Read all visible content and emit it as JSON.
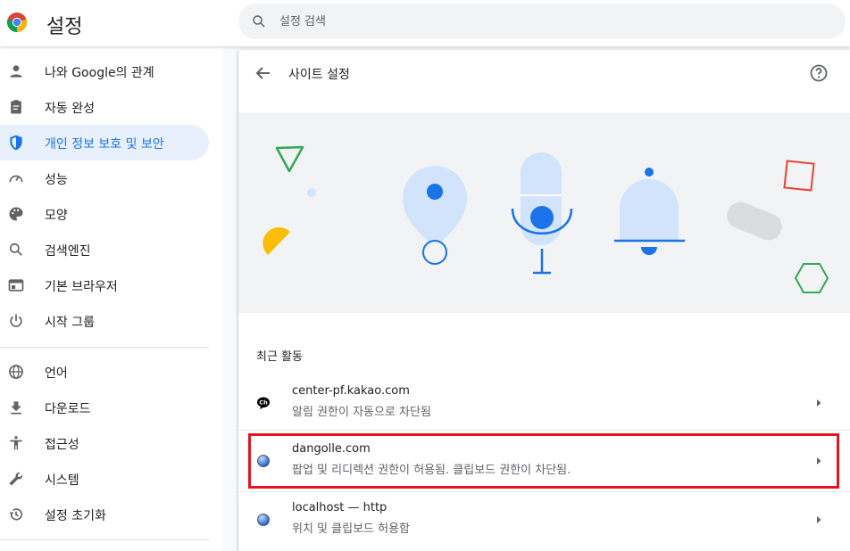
{
  "header": {
    "title": "설정",
    "search_placeholder": "설정 검색"
  },
  "sidebar": {
    "items": [
      {
        "label": "나와 Google의 관계",
        "icon": "person-icon"
      },
      {
        "label": "자동 완성",
        "icon": "clipboard-icon"
      },
      {
        "label": "개인 정보 보호 및 보안",
        "icon": "shield-icon",
        "active": true
      },
      {
        "label": "성능",
        "icon": "speedometer-icon"
      },
      {
        "label": "모양",
        "icon": "palette-icon"
      },
      {
        "label": "검색엔진",
        "icon": "search-icon"
      },
      {
        "label": "기본 브라우저",
        "icon": "browser-window-icon"
      },
      {
        "label": "시작 그룹",
        "icon": "power-icon"
      },
      {
        "label": "언어",
        "icon": "globe-icon"
      },
      {
        "label": "다운로드",
        "icon": "download-icon"
      },
      {
        "label": "접근성",
        "icon": "accessibility-icon"
      },
      {
        "label": "시스템",
        "icon": "wrench-icon"
      },
      {
        "label": "설정 초기화",
        "icon": "history-icon"
      }
    ]
  },
  "main": {
    "title": "사이트 설정",
    "recent_activity_title": "최근 활동",
    "sites": [
      {
        "name": "center-pf.kakao.com",
        "desc": "알림 권한이 자동으로 차단됨",
        "icon": "kakao-channel-icon"
      },
      {
        "name": "dangolle.com",
        "desc": "팝업 및 리디렉션 권한이 허용됨. 클립보드 권한이 차단됨.",
        "icon": "globe-favicon-icon"
      },
      {
        "name": "localhost — http",
        "desc": "위치 및 클립보드 허용함",
        "icon": "globe-favicon-icon"
      }
    ]
  },
  "colors": {
    "accent": "#1a73e8",
    "active_bg": "#e8f0fe",
    "highlight": "#e3141f",
    "illustration_blue": "#d2e3fc"
  }
}
